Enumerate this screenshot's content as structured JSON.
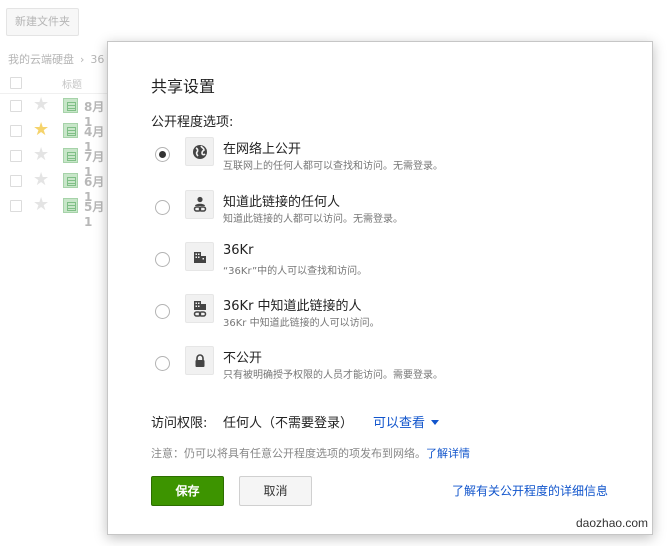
{
  "background": {
    "new_folder_label": "新建文件夹",
    "breadcrumb": [
      "我的云端硬盘",
      "36"
    ],
    "title_header": "标题",
    "rows": [
      {
        "name": "8月1",
        "starred": false
      },
      {
        "name": "4月1",
        "starred": true
      },
      {
        "name": "7月1",
        "starred": false
      },
      {
        "name": "6月1",
        "starred": false
      },
      {
        "name": "5月1",
        "starred": false
      }
    ]
  },
  "dialog": {
    "title": "共享设置",
    "visibility_label": "公开程度选项:",
    "options": [
      {
        "title": "在网络上公开",
        "desc": "互联网上的任何人都可以查找和访问。无需登录。",
        "icon": "globe-icon",
        "checked": true
      },
      {
        "title": "知道此链接的任何人",
        "desc": "知道此链接的人都可以访问。无需登录。",
        "icon": "person-link-icon",
        "checked": false
      },
      {
        "title": "36Kr",
        "desc": "“36Kr”中的人可以查找和访问。",
        "icon": "building-icon",
        "checked": false
      },
      {
        "title": "36Kr 中知道此链接的人",
        "desc": "36Kr 中知道此链接的人可以访问。",
        "icon": "building-link-icon",
        "checked": false
      },
      {
        "title": "不公开",
        "desc": "只有被明确授予权限的人员才能访问。需要登录。",
        "icon": "lock-icon",
        "checked": false
      }
    ],
    "access_label": "访问权限:",
    "access_value": "任何人（不需要登录）",
    "access_dropdown": "可以查看",
    "note_text": "注意：仍可以将具有任意公开程度选项的项发布到网络。",
    "note_link": "了解详情",
    "save_label": "保存",
    "cancel_label": "取消",
    "learn_more": "了解有关公开程度的详细信息"
  },
  "watermark": "daozhao.com",
  "colors": {
    "save": "#3d9400",
    "link": "#1155cc"
  }
}
